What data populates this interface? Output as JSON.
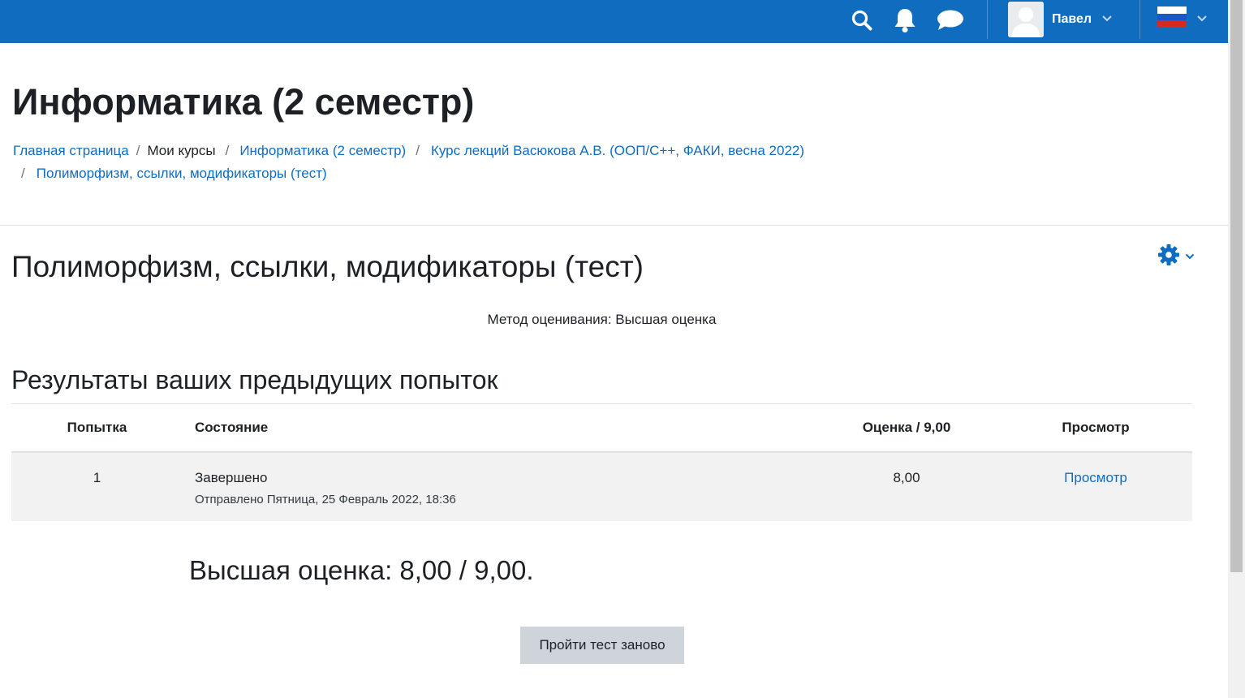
{
  "navbar": {
    "bg_color": "#0f6cbf",
    "icons": [
      "search-icon",
      "bell-icon",
      "chat-icon"
    ],
    "user_name": "Павел",
    "language_flag": "flag-ru-icon"
  },
  "header": {
    "course_title": "Информатика (2 семестр)",
    "breadcrumb": [
      {
        "label": "Главная страница",
        "link": true
      },
      {
        "label": "Мои курсы",
        "link": false
      },
      {
        "label": "Информатика (2 семестр)",
        "link": true
      },
      {
        "label": "Курс лекций Васюкова А.В. (ООП/С++, ФАКИ, весна 2022)",
        "link": true
      },
      {
        "label": "Полиморфизм, ссылки, модификаторы (тест)",
        "link": true
      }
    ]
  },
  "quiz": {
    "title": "Полиморфизм, ссылки, модификаторы (тест)",
    "grade_method": "Метод оценивания: Высшая оценка",
    "results_heading": "Результаты ваших предыдущих попыток",
    "table": {
      "headers": [
        "Попытка",
        "Состояние",
        "Оценка / 9,00",
        "Просмотр"
      ],
      "rows": [
        {
          "attempt": "1",
          "state": "Завершено",
          "submitted": "Отправлено Пятница, 25 Февраль 2022, 18:36",
          "grade": "8,00",
          "review": "Просмотр"
        }
      ]
    },
    "highest_grade": "Высшая оценка: 8,00 / 9,00.",
    "reattempt_button": "Пройти тест заново"
  },
  "colors": {
    "link": "#0f6cbf",
    "row_bg": "#f2f2f2",
    "button_bg": "#ced4da"
  }
}
